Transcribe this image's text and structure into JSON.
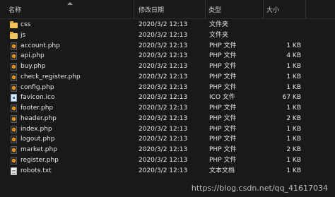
{
  "columns": {
    "name": "名称",
    "date": "修改日期",
    "type": "类型",
    "size": "大小"
  },
  "files": [
    {
      "name": "css",
      "date": "2020/3/2 12:13",
      "type": "文件夹",
      "size": "",
      "icon": "folder-icon"
    },
    {
      "name": "js",
      "date": "2020/3/2 12:13",
      "type": "文件夹",
      "size": "",
      "icon": "folder-icon"
    },
    {
      "name": "account.php",
      "date": "2020/3/2 12:13",
      "type": "PHP 文件",
      "size": "1 KB",
      "icon": "php-file-icon"
    },
    {
      "name": "api.php",
      "date": "2020/3/2 12:13",
      "type": "PHP 文件",
      "size": "4 KB",
      "icon": "php-file-icon"
    },
    {
      "name": "buy.php",
      "date": "2020/3/2 12:13",
      "type": "PHP 文件",
      "size": "1 KB",
      "icon": "php-file-icon"
    },
    {
      "name": "check_register.php",
      "date": "2020/3/2 12:13",
      "type": "PHP 文件",
      "size": "1 KB",
      "icon": "php-file-icon"
    },
    {
      "name": "config.php",
      "date": "2020/3/2 12:13",
      "type": "PHP 文件",
      "size": "1 KB",
      "icon": "php-file-icon"
    },
    {
      "name": "favicon.ico",
      "date": "2020/3/2 12:13",
      "type": "ICO 文件",
      "size": "67 KB",
      "icon": "ico-file-icon"
    },
    {
      "name": "footer.php",
      "date": "2020/3/2 12:13",
      "type": "PHP 文件",
      "size": "1 KB",
      "icon": "php-file-icon"
    },
    {
      "name": "header.php",
      "date": "2020/3/2 12:13",
      "type": "PHP 文件",
      "size": "2 KB",
      "icon": "php-file-icon"
    },
    {
      "name": "index.php",
      "date": "2020/3/2 12:13",
      "type": "PHP 文件",
      "size": "1 KB",
      "icon": "php-file-icon"
    },
    {
      "name": "logout.php",
      "date": "2020/3/2 12:13",
      "type": "PHP 文件",
      "size": "1 KB",
      "icon": "php-file-icon"
    },
    {
      "name": "market.php",
      "date": "2020/3/2 12:13",
      "type": "PHP 文件",
      "size": "2 KB",
      "icon": "php-file-icon"
    },
    {
      "name": "register.php",
      "date": "2020/3/2 12:13",
      "type": "PHP 文件",
      "size": "1 KB",
      "icon": "php-file-icon"
    },
    {
      "name": "robots.txt",
      "date": "2020/3/2 12:13",
      "type": "文本文档",
      "size": "1 KB",
      "icon": "text-file-icon"
    }
  ],
  "watermark": "https://blog.csdn.net/qq_41617034"
}
